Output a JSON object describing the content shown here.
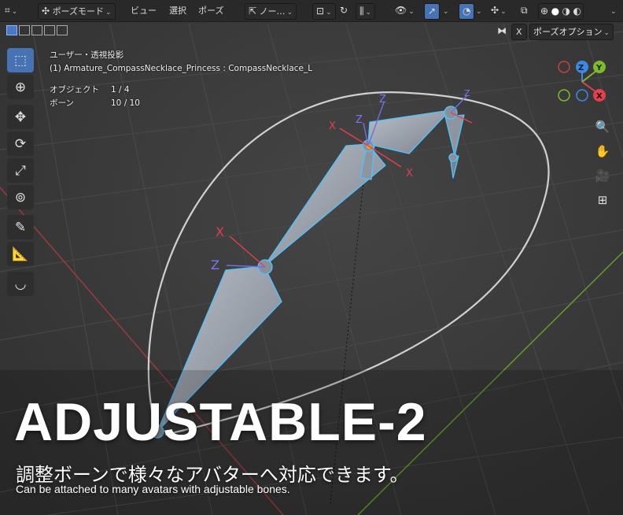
{
  "header": {
    "pose_mode": "ポーズモード",
    "menu_view": "ビュー",
    "menu_select": "選択",
    "menu_pose": "ポーズ",
    "transform_orientation": "ノー…",
    "x_axis_label": "X",
    "pose_options": "ポーズオプション"
  },
  "overlay": {
    "view_name": "ユーザー・透視投影",
    "active_object": "(1) Armature_CompassNecklace_Princess : CompassNecklace_L",
    "objects_label": "オブジェクト",
    "objects_value": "1 / 4",
    "bones_label": "ボーン",
    "bones_value": "10 / 10"
  },
  "gizmo": {
    "z": "Z",
    "y": "Y",
    "x": "X"
  },
  "bone_axes": {
    "x": "X",
    "z": "Z"
  },
  "caption": {
    "title": "ADJUSTABLE-2",
    "subtitle_jp": "調整ボーンで様々なアバターへ対応できます。",
    "subtitle_en": "Can be attached to many avatars with adjustable bones."
  },
  "colors": {
    "axis_x": "#e0404f",
    "axis_y": "#7dba2c",
    "axis_z": "#3b8ae0",
    "bone_select": "#4fc3ff",
    "active_tool": "#4772b3"
  }
}
